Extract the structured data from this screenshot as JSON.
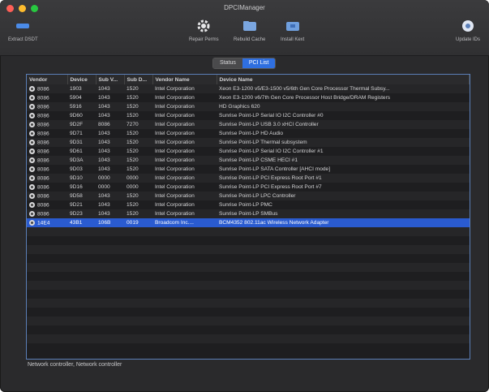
{
  "app": {
    "title": "DPCIManager"
  },
  "toolbar": {
    "extract_label": "Extract DSDT",
    "repair_label": "Repair Perms",
    "rebuild_label": "Rebuild Cache",
    "install_label": "Install Kext",
    "update_label": "Update IDs"
  },
  "tabs": {
    "status_label": "Status",
    "pci_label": "PCI List",
    "active": "pci_list"
  },
  "table": {
    "columns": [
      "Vendor",
      "Device",
      "Sub V...",
      "Sub D...",
      "Vendor Name",
      "Device Name"
    ],
    "rows": [
      [
        "8086",
        "1903",
        "1043",
        "1520",
        "Intel Corporation",
        "Xeon E3-1200 v5/E3-1500 v5/6th Gen Core Processor Thermal Subsy..."
      ],
      [
        "8086",
        "5904",
        "1043",
        "1520",
        "Intel Corporation",
        "Xeon E3-1200 v6/7th Gen Core Processor Host Bridge/DRAM Registers"
      ],
      [
        "8086",
        "5916",
        "1043",
        "1520",
        "Intel Corporation",
        "HD Graphics 620"
      ],
      [
        "8086",
        "9D60",
        "1043",
        "1520",
        "Intel Corporation",
        "Sunrise Point-LP Serial IO I2C Controller #0"
      ],
      [
        "8086",
        "9D2F",
        "8086",
        "7270",
        "Intel Corporation",
        "Sunrise Point-LP USB 3.0 xHCI Controller"
      ],
      [
        "8086",
        "9D71",
        "1043",
        "1520",
        "Intel Corporation",
        "Sunrise Point-LP HD Audio"
      ],
      [
        "8086",
        "9D31",
        "1043",
        "1520",
        "Intel Corporation",
        "Sunrise Point-LP Thermal subsystem"
      ],
      [
        "8086",
        "9D61",
        "1043",
        "1520",
        "Intel Corporation",
        "Sunrise Point-LP Serial IO I2C Controller #1"
      ],
      [
        "8086",
        "9D3A",
        "1043",
        "1520",
        "Intel Corporation",
        "Sunrise Point-LP CSME HECI #1"
      ],
      [
        "8086",
        "9D03",
        "1043",
        "1520",
        "Intel Corporation",
        "Sunrise Point-LP SATA Controller [AHCI mode]"
      ],
      [
        "8086",
        "9D10",
        "0000",
        "0000",
        "Intel Corporation",
        "Sunrise Point-LP PCI Express Root Port #1"
      ],
      [
        "8086",
        "9D16",
        "0000",
        "0000",
        "Intel Corporation",
        "Sunrise Point-LP PCI Express Root Port #7"
      ],
      [
        "8086",
        "9D58",
        "1043",
        "1520",
        "Intel Corporation",
        "Sunrise Point-LP LPC Controller"
      ],
      [
        "8086",
        "9D21",
        "1043",
        "1520",
        "Intel Corporation",
        "Sunrise Point-LP PMC"
      ],
      [
        "8086",
        "9D23",
        "1043",
        "1520",
        "Intel Corporation",
        "Sunrise Point-LP SMBus"
      ],
      [
        "14E4",
        "43B1",
        "106B",
        "0019",
        "Broadcom Inc....",
        "BCM4352 802.11ac Wireless Network Adapter"
      ]
    ],
    "selected_index": 15
  },
  "status_bar": {
    "text": "Network controller, Network controller"
  },
  "colors": {
    "accent": "#2f6fe0",
    "selection": "#2a5bd0",
    "background": "#2a2a2c"
  }
}
